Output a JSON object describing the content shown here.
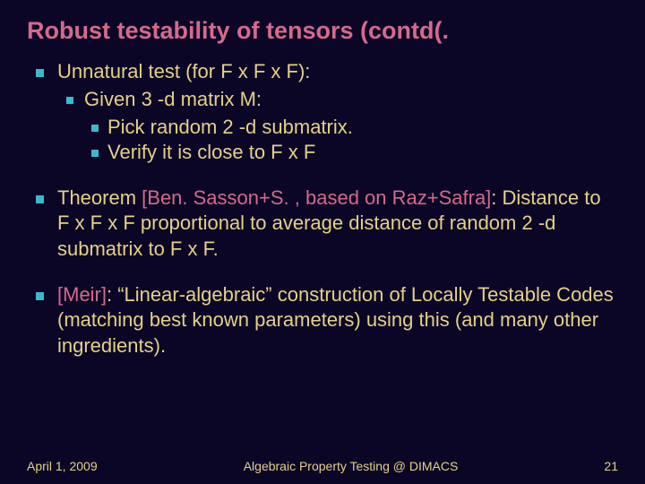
{
  "title": "Robust testability of tensors (contd(.",
  "bullets": {
    "b1": {
      "line1": "Unnatural test (for F x F x F):",
      "s1": "Given 3 -d matrix M:",
      "s1a": "Pick random 2 -d submatrix.",
      "s1b": "Verify it is close to F x F"
    },
    "b2": {
      "pre": "Theorem ",
      "cite": "[Ben. Sasson+S. , based on Raz+Safra]",
      "post": ": Distance to F x F x F proportional to average distance of random 2 -d submatrix to F x F."
    },
    "b3": {
      "cite": "[Meir]",
      "post": ": “Linear-algebraic” construction of Locally Testable Codes (matching best known parameters) using this (and many other ingredients)."
    }
  },
  "footer": {
    "date": "April 1, 2009",
    "center": "Algebraic Property Testing @ DIMACS",
    "page": "21"
  }
}
